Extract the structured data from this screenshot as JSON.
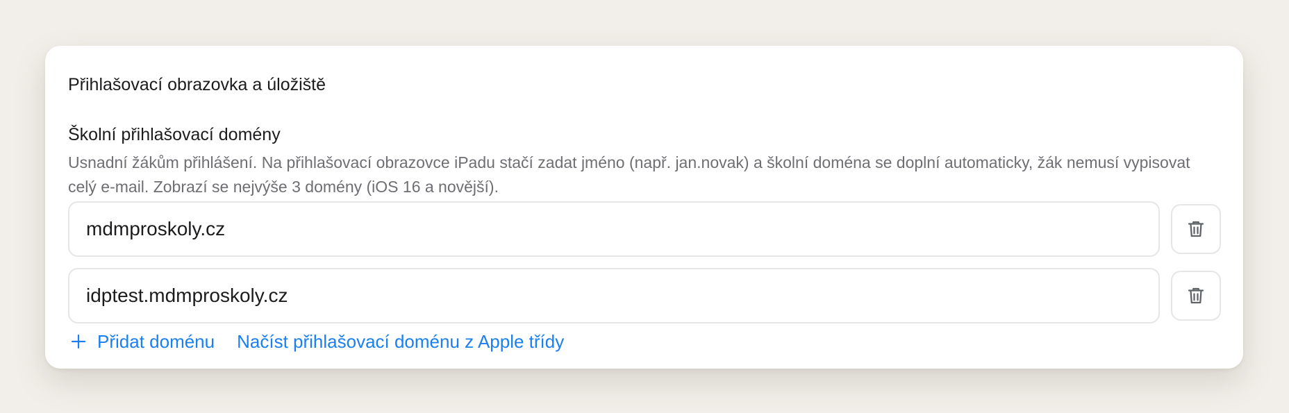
{
  "card": {
    "title": "Přihlašovací obrazovka a úložiště"
  },
  "section": {
    "title": "Školní přihlašovací domény",
    "description": "Usnadní žákům přihlášení. Na přihlašovací obrazovce iPadu stačí zadat jméno (např. jan.novak) a školní doména se doplní automaticky, žák nemusí vypisovat celý e-mail. Zobrazí se nejvýše 3 domény (iOS 16 a novější)."
  },
  "domains": [
    {
      "value": "mdmproskoly.cz",
      "delete_icon": "trash-icon"
    },
    {
      "value": "idptest.mdmproskoly.cz",
      "delete_icon": "trash-icon"
    }
  ],
  "actions": {
    "add_icon": "plus-icon",
    "add_label": "Přidat doménu",
    "import_label": "Načíst přihlašovací doménu z Apple třídy"
  },
  "colors": {
    "accent": "#1a7ff0",
    "background": "#f2efea",
    "card": "#ffffff",
    "text_primary": "#1c1c1e",
    "text_secondary": "#6e6e73",
    "border": "#e6e6e9"
  }
}
